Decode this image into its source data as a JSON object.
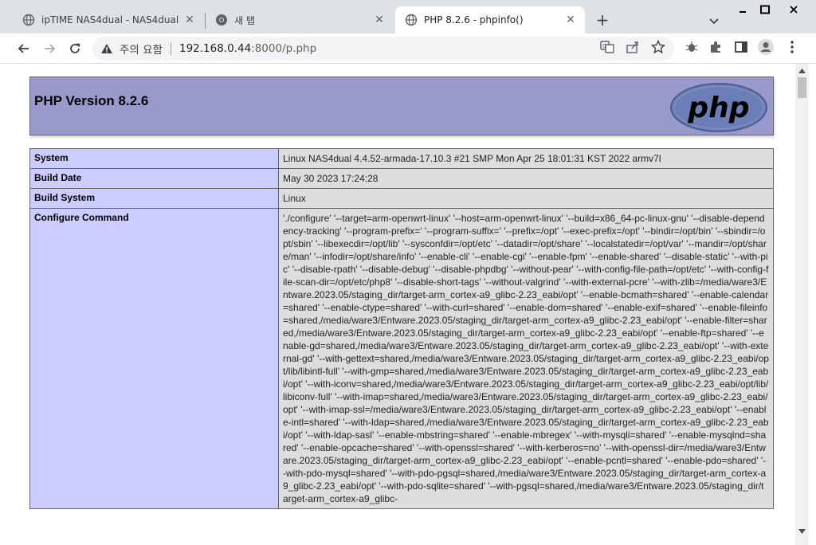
{
  "browser": {
    "tabs": [
      {
        "title": "ipTIME NAS4dual - NAS4dual",
        "icon": "globe-icon",
        "active": false
      },
      {
        "title": "새 탭",
        "icon": "chrome-icon",
        "active": false
      },
      {
        "title": "PHP 8.2.6 - phpinfo()",
        "icon": "globe-icon",
        "active": true
      }
    ],
    "new_tab": "+",
    "address": {
      "security_label": "주의 요함",
      "url_host": "192.168.0.44",
      "url_rest": ":8000/p.php"
    }
  },
  "page": {
    "heading": "PHP Version 8.2.6",
    "logo_text": "php",
    "rows": [
      {
        "label": "System",
        "value": "Linux NAS4dual 4.4.52-armada-17.10.3 #21 SMP Mon Apr 25 18:01:31 KST 2022 armv7l"
      },
      {
        "label": "Build Date",
        "value": "May 30 2023 17:24:28"
      },
      {
        "label": "Build System",
        "value": "Linux"
      },
      {
        "label": "Configure Command",
        "value": "'./configure' '--target=arm-openwrt-linux' '--host=arm-openwrt-linux' '--build=x86_64-pc-linux-gnu' '--disable-dependency-tracking' '--program-prefix=' '--program-suffix=' '--prefix=/opt' '--exec-prefix=/opt' '--bindir=/opt/bin' '--sbindir=/opt/sbin' '--libexecdir=/opt/lib' '--sysconfdir=/opt/etc' '--datadir=/opt/share' '--localstatedir=/opt/var' '--mandir=/opt/share/man' '--infodir=/opt/share/info' '--enable-cli' '--enable-cgi' '--enable-fpm' '--enable-shared' '--disable-static' '--with-pic' '--disable-rpath' '--disable-debug' '--disable-phpdbg' '--without-pear' '--with-config-file-path=/opt/etc' '--with-config-file-scan-dir=/opt/etc/php8' '--disable-short-tags' '--without-valgrind' '--with-external-pcre' '--with-zlib=/media/ware3/Entware.2023.05/staging_dir/target-arm_cortex-a9_glibc-2.23_eabi/opt' '--enable-bcmath=shared' '--enable-calendar=shared' '--enable-ctype=shared' '--with-curl=shared' '--enable-dom=shared' '--enable-exif=shared' '--enable-fileinfo=shared,/media/ware3/Entware.2023.05/staging_dir/target-arm_cortex-a9_glibc-2.23_eabi/opt' '--enable-filter=shared,/media/ware3/Entware.2023.05/staging_dir/target-arm_cortex-a9_glibc-2.23_eabi/opt' '--enable-ftp=shared' '--enable-gd=shared,/media/ware3/Entware.2023.05/staging_dir/target-arm_cortex-a9_glibc-2.23_eabi/opt' '--with-external-gd' '--with-gettext=shared,/media/ware3/Entware.2023.05/staging_dir/target-arm_cortex-a9_glibc-2.23_eabi/opt/lib/libintl-full' '--with-gmp=shared,/media/ware3/Entware.2023.05/staging_dir/target-arm_cortex-a9_glibc-2.23_eabi/opt' '--with-iconv=shared,/media/ware3/Entware.2023.05/staging_dir/target-arm_cortex-a9_glibc-2.23_eabi/opt/lib/libiconv-full' '--with-imap=shared,/media/ware3/Entware.2023.05/staging_dir/target-arm_cortex-a9_glibc-2.23_eabi/opt' '--with-imap-ssl=/media/ware3/Entware.2023.05/staging_dir/target-arm_cortex-a9_glibc-2.23_eabi/opt' '--enable-intl=shared' '--with-ldap=shared,/media/ware3/Entware.2023.05/staging_dir/target-arm_cortex-a9_glibc-2.23_eabi/opt' '--with-ldap-sasl' '--enable-mbstring=shared' '--enable-mbregex' '--with-mysqli=shared' '--enable-mysqlnd=shared' '--enable-opcache=shared' '--with-openssl=shared' '--with-kerberos=no' '--with-openssl-dir=/media/ware3/Entware.2023.05/staging_dir/target-arm_cortex-a9_glibc-2.23_eabi/opt' '--enable-pcntl=shared' '--enable-pdo=shared' '--with-pdo-mysql=shared' '--with-pdo-pgsql=shared,/media/ware3/Entware.2023.05/staging_dir/target-arm_cortex-a9_glibc-2.23_eabi/opt' '--with-pdo-sqlite=shared' '--with-pgsql=shared,/media/ware3/Entware.2023.05/staging_dir/target-arm_cortex-a9_glibc-"
      }
    ]
  },
  "colors": {
    "tabstrip": "#dee1e6",
    "php_header": "#9999cc",
    "label_cell": "#ccccff",
    "value_cell": "#dddddd",
    "logo": "#6c7eb7"
  }
}
